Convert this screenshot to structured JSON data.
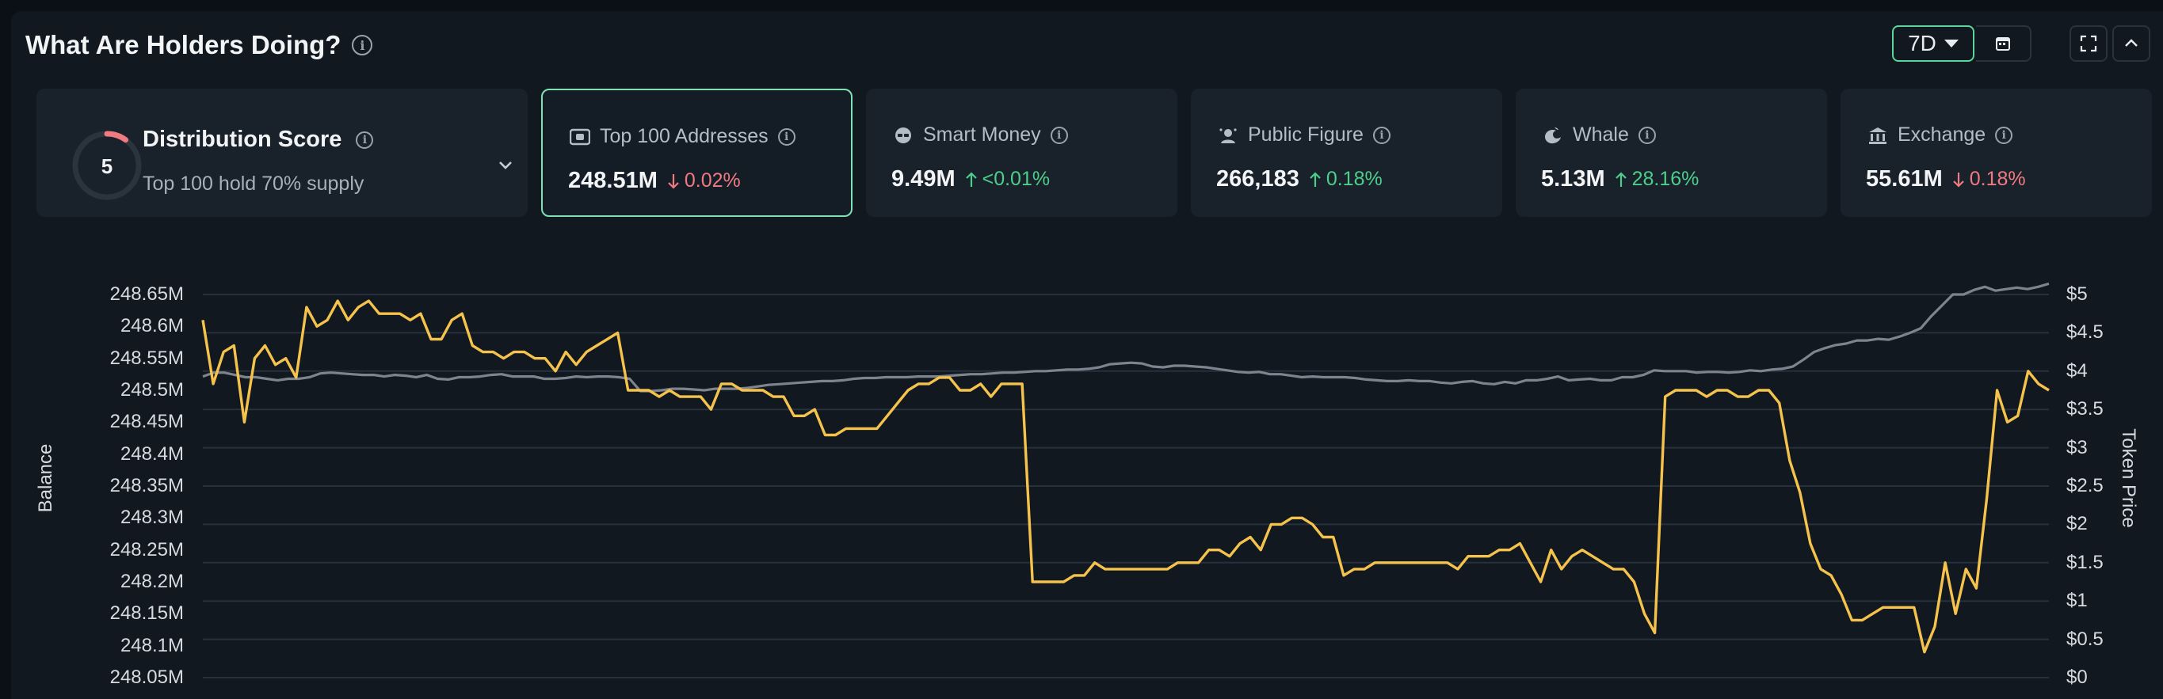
{
  "header": {
    "title": "What Are Holders Doing?",
    "range_label": "7D",
    "icons": [
      "info-icon",
      "chevron-down-icon",
      "calendar-icon",
      "fullscreen-icon",
      "chevron-up-icon"
    ]
  },
  "distribution": {
    "score": "5",
    "title": "Distribution Score",
    "subtitle": "Top 100 hold 70% supply",
    "score_fraction": 0.1
  },
  "cards": [
    {
      "label": "Top 100 Addresses",
      "value": "248.51M",
      "change": "0.02%",
      "direction": "down",
      "icon": "wallet-icon"
    },
    {
      "label": "Smart Money",
      "value": "9.49M",
      "change": "<0.01%",
      "direction": "up",
      "icon": "smart-money-icon"
    },
    {
      "label": "Public Figure",
      "value": "266,183",
      "change": "0.18%",
      "direction": "up",
      "icon": "public-figure-icon"
    },
    {
      "label": "Whale",
      "value": "5.13M",
      "change": "28.16%",
      "direction": "up",
      "icon": "whale-icon"
    },
    {
      "label": "Exchange",
      "value": "55.61M",
      "change": "0.18%",
      "direction": "down",
      "icon": "bank-icon"
    }
  ],
  "colors": {
    "accent": "#5fd49a",
    "up": "#4ccf8a",
    "down": "#f07a82",
    "balance_line": "#f5c24b",
    "price_line": "#7d848d"
  },
  "chart_data": {
    "type": "line",
    "ylabel": "Balance",
    "y2label": "Token Price",
    "y_ticks": [
      "248.65M",
      "248.6M",
      "248.55M",
      "248.5M",
      "248.45M",
      "248.4M",
      "248.35M",
      "248.3M",
      "248.25M",
      "248.2M",
      "248.15M",
      "248.1M",
      "248.05M"
    ],
    "y2_ticks": [
      "$5",
      "$4.5",
      "$4",
      "$3.5",
      "$3",
      "$2.5",
      "$2",
      "$1.5",
      "$1",
      "$0.5",
      "$0"
    ],
    "ylim": [
      248.05,
      248.65
    ],
    "y2lim": [
      0,
      5
    ],
    "grid": true,
    "series": [
      {
        "name": "Balance",
        "axis": "left",
        "values": [
          248.61,
          248.51,
          248.56,
          248.57,
          248.45,
          248.55,
          248.57,
          248.54,
          248.55,
          248.52,
          248.63,
          248.6,
          248.61,
          248.64,
          248.61,
          248.63,
          248.64,
          248.62,
          248.62,
          248.62,
          248.61,
          248.62,
          248.58,
          248.58,
          248.61,
          248.62,
          248.57,
          248.56,
          248.56,
          248.55,
          248.56,
          248.56,
          248.55,
          248.55,
          248.53,
          248.56,
          248.54,
          248.56,
          248.57,
          248.58,
          248.59,
          248.5,
          248.5,
          248.5,
          248.49,
          248.5,
          248.49,
          248.49,
          248.49,
          248.47,
          248.51,
          248.51,
          248.5,
          248.5,
          248.5,
          248.49,
          248.49,
          248.46,
          248.46,
          248.47,
          248.43,
          248.43,
          248.44,
          248.44,
          248.44,
          248.44,
          248.46,
          248.48,
          248.5,
          248.51,
          248.51,
          248.52,
          248.52,
          248.5,
          248.5,
          248.51,
          248.49,
          248.51,
          248.51,
          248.51,
          248.2,
          248.2,
          248.2,
          248.2,
          248.21,
          248.21,
          248.23,
          248.22,
          248.22,
          248.22,
          248.22,
          248.22,
          248.22,
          248.22,
          248.23,
          248.23,
          248.23,
          248.25,
          248.25,
          248.24,
          248.26,
          248.27,
          248.25,
          248.29,
          248.29,
          248.3,
          248.3,
          248.29,
          248.27,
          248.27,
          248.21,
          248.22,
          248.22,
          248.23,
          248.23,
          248.23,
          248.23,
          248.23,
          248.23,
          248.23,
          248.23,
          248.22,
          248.24,
          248.24,
          248.24,
          248.25,
          248.25,
          248.26,
          248.23,
          248.2,
          248.25,
          248.22,
          248.24,
          248.25,
          248.24,
          248.23,
          248.22,
          248.22,
          248.2,
          248.15,
          248.12,
          248.49,
          248.5,
          248.5,
          248.5,
          248.49,
          248.5,
          248.5,
          248.49,
          248.49,
          248.5,
          248.5,
          248.48,
          248.39,
          248.34,
          248.26,
          248.22,
          248.21,
          248.18,
          248.14,
          248.14,
          248.15,
          248.16,
          248.16,
          248.16,
          248.16,
          248.09,
          248.13,
          248.23,
          248.15,
          248.22,
          248.19,
          248.33,
          248.5,
          248.45,
          248.46,
          248.53,
          248.51,
          248.5
        ]
      },
      {
        "name": "Token Price",
        "axis": "right",
        "values": [
          3.93,
          3.98,
          3.98,
          3.95,
          3.92,
          3.92,
          3.9,
          3.88,
          3.9,
          3.9,
          3.92,
          3.97,
          3.98,
          3.97,
          3.96,
          3.95,
          3.95,
          3.93,
          3.95,
          3.94,
          3.92,
          3.95,
          3.9,
          3.89,
          3.92,
          3.92,
          3.93,
          3.95,
          3.96,
          3.93,
          3.93,
          3.93,
          3.9,
          3.9,
          3.91,
          3.93,
          3.92,
          3.93,
          3.93,
          3.92,
          3.9,
          3.74,
          3.74,
          3.75,
          3.77,
          3.77,
          3.76,
          3.75,
          3.77,
          3.77,
          3.77,
          3.78,
          3.8,
          3.82,
          3.83,
          3.84,
          3.85,
          3.86,
          3.87,
          3.87,
          3.88,
          3.9,
          3.91,
          3.91,
          3.92,
          3.92,
          3.92,
          3.93,
          3.93,
          3.93,
          3.94,
          3.95,
          3.96,
          3.96,
          3.97,
          3.98,
          3.98,
          3.99,
          4.0,
          4.0,
          4.01,
          4.02,
          4.02,
          4.03,
          4.05,
          4.09,
          4.1,
          4.11,
          4.1,
          4.06,
          4.05,
          4.07,
          4.07,
          4.06,
          4.05,
          4.03,
          4.01,
          3.99,
          3.98,
          3.99,
          3.96,
          3.96,
          3.94,
          3.92,
          3.93,
          3.92,
          3.92,
          3.92,
          3.91,
          3.89,
          3.88,
          3.87,
          3.87,
          3.88,
          3.87,
          3.87,
          3.85,
          3.84,
          3.86,
          3.87,
          3.84,
          3.83,
          3.86,
          3.84,
          3.88,
          3.88,
          3.9,
          3.93,
          3.88,
          3.89,
          3.9,
          3.88,
          3.88,
          3.92,
          3.92,
          3.95,
          4.01,
          4.0,
          4.0,
          4.0,
          3.98,
          3.99,
          3.99,
          3.98,
          3.99,
          4.01,
          4.0,
          4.02,
          4.03,
          4.06,
          4.15,
          4.25,
          4.3,
          4.34,
          4.36,
          4.4,
          4.4,
          4.42,
          4.41,
          4.45,
          4.5,
          4.56,
          4.72,
          4.86,
          5.0,
          5.0,
          5.06,
          5.1,
          5.05,
          5.07,
          5.09,
          5.07,
          5.1,
          5.14
        ]
      }
    ]
  }
}
